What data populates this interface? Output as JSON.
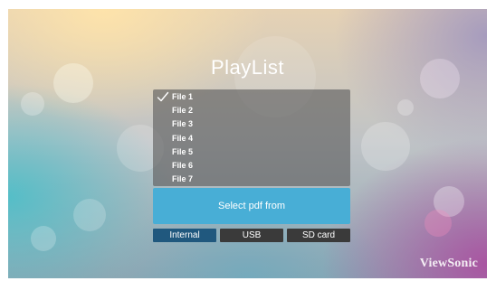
{
  "title": "PlayList",
  "files": [
    {
      "label": "File 1",
      "checked": true
    },
    {
      "label": "File 2",
      "checked": false
    },
    {
      "label": "File 3",
      "checked": false
    },
    {
      "label": "File 4",
      "checked": false
    },
    {
      "label": "File 5",
      "checked": false
    },
    {
      "label": "File 6",
      "checked": false
    },
    {
      "label": "File 7",
      "checked": false
    }
  ],
  "select_button": {
    "label": "Select pdf from"
  },
  "sources": {
    "internal": "Internal",
    "usb": "USB",
    "sd_card": "SD card",
    "selected": "internal"
  },
  "brand": {
    "logo_text": "ViewSonic"
  },
  "colors": {
    "select_button": "#48aed6",
    "tab_selected": "#20587e",
    "tab_default": "#3a3a3a",
    "list_background": "#5a5a5a"
  }
}
